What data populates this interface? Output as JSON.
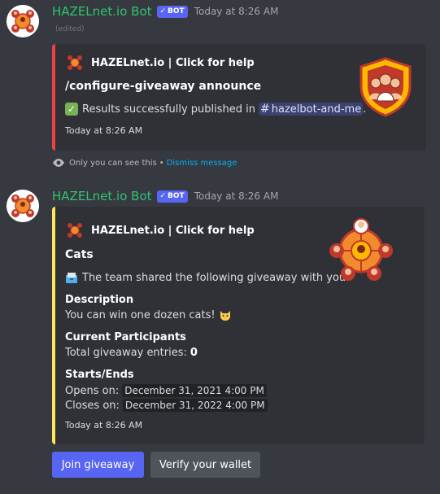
{
  "message1": {
    "username": "HAZELnet.io Bot",
    "bot_tag": "BOT",
    "timestamp": "Today at 8:26 AM",
    "edited": "(edited)",
    "embed": {
      "accent_color": "#ed4245",
      "author": "HAZELnet.io | Click for help",
      "title": "/configure-giveaway announce",
      "description_text": "Results successfully published in",
      "channel": "hazelbot-and-me",
      "description_end": ".",
      "footer": "Today at 8:26 AM",
      "thumbnail": "shield-team-icon"
    },
    "ephemeral": {
      "notice": "Only you can see this",
      "separator": "•",
      "dismiss": "Dismiss message"
    }
  },
  "message2": {
    "username": "HAZELnet.io Bot",
    "bot_tag": "BOT",
    "timestamp": "Today at 8:26 AM",
    "embed": {
      "accent_color": "#fee75c",
      "author": "HAZELnet.io | Click for help",
      "title": "Cats",
      "description": "The team shared the following giveaway with you.",
      "fields": {
        "description_name": "Description",
        "description_value": "You can win one dozen cats!",
        "participants_name": "Current Participants",
        "participants_label": "Total giveaway entries:",
        "participants_count": "0",
        "dates_name": "Starts/Ends",
        "opens_label": "Opens on:",
        "opens_value": "December 31, 2021 4:00 PM",
        "closes_label": "Closes on:",
        "closes_value": "December 31, 2022 4:00 PM"
      },
      "footer": "Today at 8:26 AM",
      "thumbnail": "team-network-icon"
    },
    "buttons": {
      "join": "Join giveaway",
      "verify": "Verify your wallet"
    }
  },
  "colors": {
    "background": "#36393f",
    "embed_bg": "#2f3136",
    "username": "#2dc770",
    "blurple": "#5865f2",
    "secondary_button": "#4f545c",
    "link": "#00aff4"
  }
}
